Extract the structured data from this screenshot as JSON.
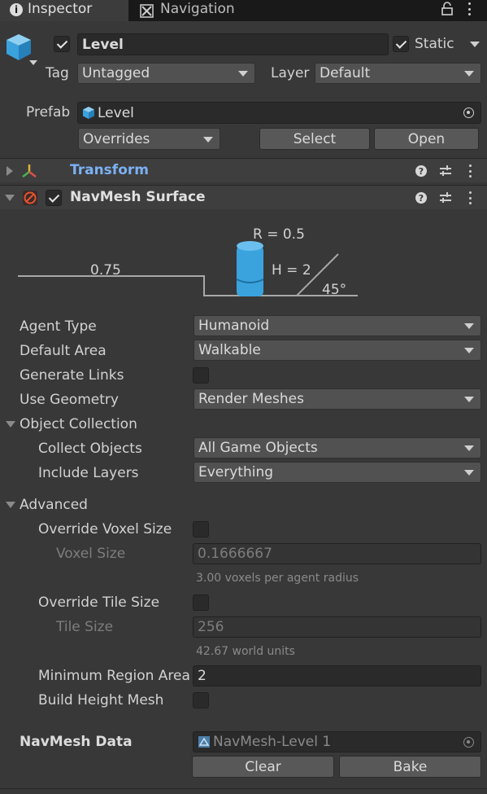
{
  "tabs": {
    "inspector": "Inspector",
    "navigation": "Navigation"
  },
  "object": {
    "name": "Level",
    "static_label": "Static",
    "tag_label": "Tag",
    "tag_value": "Untagged",
    "layer_label": "Layer",
    "layer_value": "Default",
    "prefab_label": "Prefab",
    "prefab_value": "Level",
    "overrides": "Overrides",
    "select": "Select",
    "open": "Open"
  },
  "components": {
    "transform": "Transform",
    "navmesh_surface": "NavMesh Surface"
  },
  "diagram": {
    "radius": "R = 0.5",
    "height": "H = 2",
    "step": "0.75",
    "slope": "45°"
  },
  "fields": {
    "agent_type": {
      "label": "Agent Type",
      "value": "Humanoid"
    },
    "default_area": {
      "label": "Default Area",
      "value": "Walkable"
    },
    "generate_links": {
      "label": "Generate Links"
    },
    "use_geometry": {
      "label": "Use Geometry",
      "value": "Render Meshes"
    },
    "object_collection": {
      "label": "Object Collection"
    },
    "collect_objects": {
      "label": "Collect Objects",
      "value": "All Game Objects"
    },
    "include_layers": {
      "label": "Include Layers",
      "value": "Everything"
    },
    "advanced": {
      "label": "Advanced"
    },
    "override_voxel_size": {
      "label": "Override Voxel Size"
    },
    "voxel_size": {
      "label": "Voxel Size",
      "value": "0.1666667",
      "hint": "3.00 voxels per agent radius"
    },
    "override_tile_size": {
      "label": "Override Tile Size"
    },
    "tile_size": {
      "label": "Tile Size",
      "value": "256",
      "hint": "42.67 world units"
    },
    "min_region_area": {
      "label": "Minimum Region Area",
      "value": "2"
    },
    "build_height_mesh": {
      "label": "Build Height Mesh"
    },
    "navmesh_data": {
      "label": "NavMesh Data",
      "value": "NavMesh-Level 1"
    }
  },
  "actions": {
    "clear": "Clear",
    "bake": "Bake"
  },
  "colors": {
    "accent_blue": "#7bb1f4",
    "cube_blue": "#3aa3dd",
    "nav_orange": "#e8542c"
  }
}
